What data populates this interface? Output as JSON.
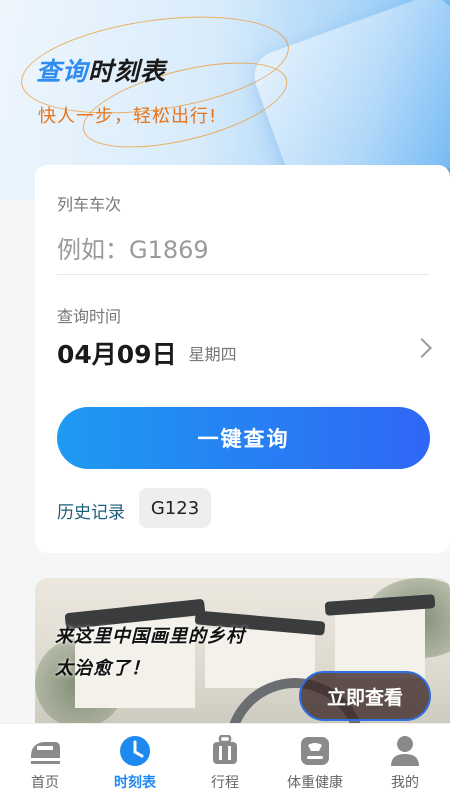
{
  "header": {
    "title_part1": "查询",
    "title_part2": "时刻表",
    "slogan": "快人一步，轻松出行!"
  },
  "form": {
    "train_label": "列车车次",
    "train_placeholder": "例如：G1869",
    "time_label": "查询时间",
    "date": "04月09日",
    "weekday": "星期四",
    "search_button": "一键查询",
    "history_label": "历史记录",
    "history_items": [
      "G123"
    ]
  },
  "banner": {
    "line1": "来这里中国画里的乡村",
    "line2": "太治愈了！",
    "button": "立即查看"
  },
  "tabs": [
    {
      "label": "首页",
      "icon": "train-icon",
      "active": false
    },
    {
      "label": "时刻表",
      "icon": "clock-icon",
      "active": true
    },
    {
      "label": "行程",
      "icon": "luggage-icon",
      "active": false
    },
    {
      "label": "体重健康",
      "icon": "scale-icon",
      "active": false
    },
    {
      "label": "我的",
      "icon": "user-icon",
      "active": false
    }
  ],
  "colors": {
    "accent": "#1e8af0",
    "slogan": "#e8741a",
    "button_start": "#1e9bf2",
    "button_end": "#2f67f5"
  }
}
